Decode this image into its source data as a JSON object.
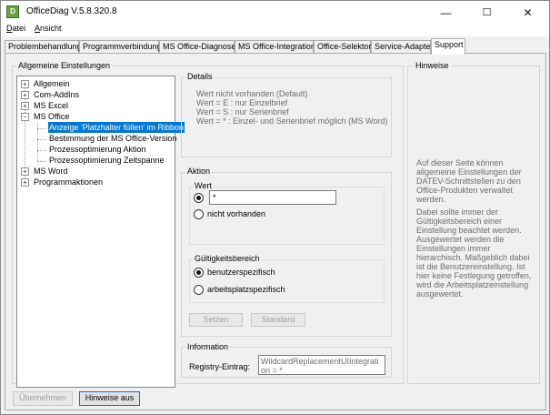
{
  "window": {
    "title": "OfficeDiag   V.5.8.320.8",
    "icon_glyph": "D",
    "minimize_glyph": "—",
    "maximize_glyph": "☐",
    "close_glyph": "✕"
  },
  "menu": {
    "datei": "Datei",
    "ansicht": "Ansicht"
  },
  "tabs": [
    {
      "label": "Problembehandlung"
    },
    {
      "label": "Programmverbindung"
    },
    {
      "label": "MS Office-Diagnose"
    },
    {
      "label": "MS Office-Integration"
    },
    {
      "label": "Office-Selektor"
    },
    {
      "label": "Service-Adapter"
    },
    {
      "label": "Support"
    }
  ],
  "settings": {
    "group_title": "Allgemeine Einstellungen",
    "tree": {
      "allgemein": "Allgemein",
      "comaddins": "Com-AddIns",
      "msexcel": "MS Excel",
      "msoffice": "MS Office",
      "child1": "Anzeige 'Platzhalter füllen' im Ribbon",
      "child2": "Bestimmung der MS Office-Version",
      "child3": "Prozessoptimierung Aktion",
      "child4": "Prozessoptimierung Zeitspanne",
      "msword": "MS Word",
      "programmaktionen": "Programmaktionen"
    }
  },
  "details": {
    "title": "Details",
    "line1": "Wert nicht vorhanden (Default)",
    "line2": "Wert = E : nur Einzelbrief",
    "line3": "Wert = S : nur Serienbrief",
    "line4": "Wert = * : Einzel- und Serienbrief möglich (MS Word)"
  },
  "aktion": {
    "title": "Aktion",
    "wert_title": "Wert",
    "wert_value": "*",
    "not_present": "nicht vorhanden",
    "scope_title": "Gültigkeitsbereich",
    "user_specific": "benutzerspezifisch",
    "workstation_specific": "arbeitsplatzspezifisch",
    "set_button": "Setzen",
    "default_button": "Standard"
  },
  "information": {
    "title": "Information",
    "registry_label": "Registry-Eintrag:",
    "registry_value": "WildcardReplacementUIIntegration = *"
  },
  "hints": {
    "title": "Hinweise",
    "para1": "Auf dieser Seite können allgemeine Einstellungen der DATEV-Schnittstellen zu den Office-Produkten verwaltet werden.",
    "para2": "Dabei sollte immer der Gültigkeitsbereich einer Einstellung beachtet werden. Ausgewertet werden die Einstellungen immer hierarchisch. Maßgeblich dabei ist die Benutzereinstellung. Ist hier keine Festlegung getroffen, wird die Arbeitsplatzeinstellung ausgewertet."
  },
  "footer": {
    "apply_button": "Übernehmen",
    "hints_off_button": "Hinweise aus"
  },
  "colors": {
    "selection": "#0078d7",
    "app_icon": "#6aa341"
  }
}
